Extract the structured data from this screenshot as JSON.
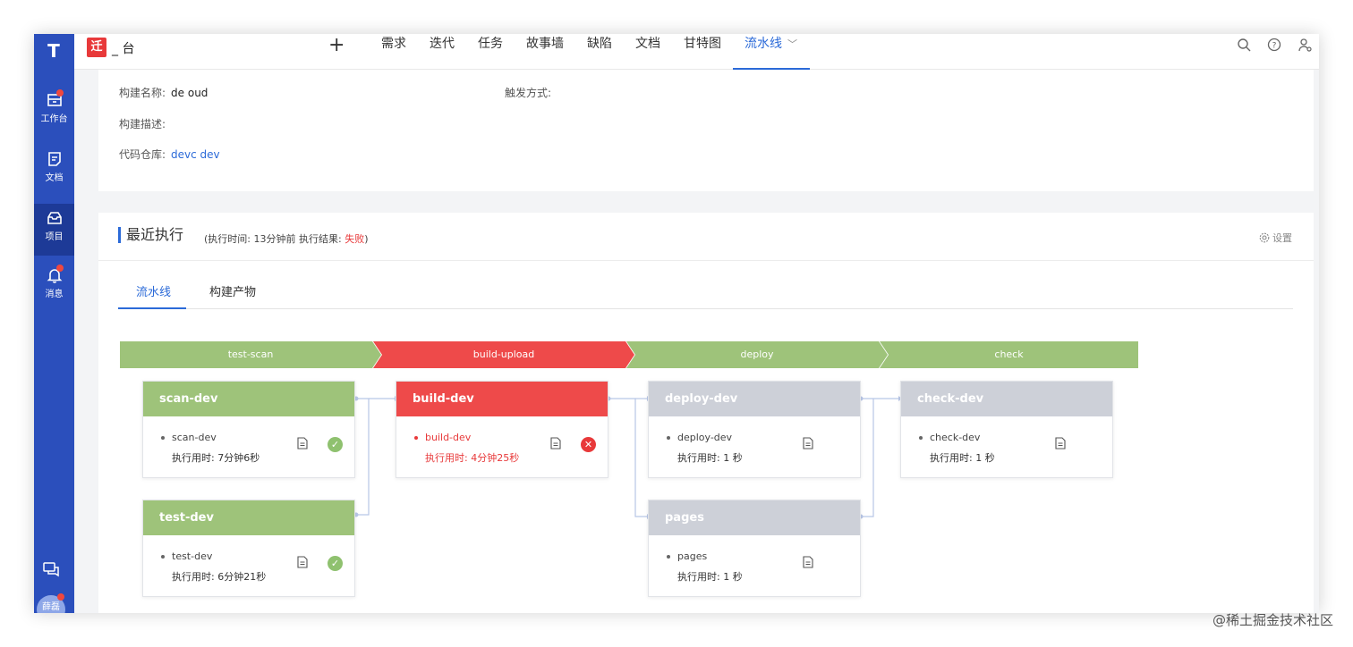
{
  "app": {
    "logo_letter": "T",
    "brand_badge": "迁",
    "brand_name": "_ 台"
  },
  "rail": {
    "items": [
      {
        "label": "工作台",
        "icon": "inbox-icon",
        "badge": true
      },
      {
        "label": "文档",
        "icon": "doc-icon",
        "badge": false
      },
      {
        "label": "项目",
        "icon": "project-icon",
        "badge": false,
        "active": true
      },
      {
        "label": "消息",
        "icon": "bell-icon",
        "badge": true
      }
    ],
    "avatar_text": "薛磊"
  },
  "nav": {
    "plus": "+",
    "tabs": [
      "需求",
      "迭代",
      "任务",
      "故事墙",
      "缺陷",
      "文档",
      "甘特图",
      "流水线"
    ],
    "active_tab": "流水线",
    "chevron": "﹀"
  },
  "build_info": {
    "name_label": "构建名称:",
    "name_value": "de          oud",
    "trigger_label": "触发方式:",
    "trigger_value": "",
    "desc_label": "构建描述:",
    "desc_value": "",
    "repo_label": "代码仓库:",
    "repo_value": "devc                     dev"
  },
  "recent": {
    "title": "最近执行",
    "meta_prefix": "(执行时间:  13分钟前    执行结果:  ",
    "result": "失败",
    "meta_suffix": ")",
    "settings": "设置",
    "tabs": [
      "流水线",
      "构建产物"
    ]
  },
  "stages": [
    {
      "label": "test-scan",
      "status": "success"
    },
    {
      "label": "build-upload",
      "status": "failed"
    },
    {
      "label": "deploy",
      "status": "success"
    },
    {
      "label": "check",
      "status": "success"
    }
  ],
  "jobs": [
    {
      "title": "scan-dev",
      "step": "scan-dev",
      "time_label": "执行用时:",
      "time": "7分钟6秒",
      "status": "success"
    },
    {
      "title": "test-dev",
      "step": "test-dev",
      "time_label": "执行用时:",
      "time": "6分钟21秒",
      "status": "success"
    },
    {
      "title": "build-dev",
      "step": "build-dev",
      "time_label": "执行用时:",
      "time": "4分钟25秒",
      "status": "failed"
    },
    {
      "title": "deploy-dev",
      "step": "deploy-dev",
      "time_label": "执行用时:",
      "time": "1 秒",
      "status": "pending"
    },
    {
      "title": "pages",
      "step": "pages",
      "time_label": "执行用时:",
      "time": "1 秒",
      "status": "pending"
    },
    {
      "title": "check-dev",
      "step": "check-dev",
      "time_label": "执行用时:",
      "time": "1 秒",
      "status": "pending"
    }
  ],
  "colors": {
    "success": "#9ec37a",
    "failed": "#ee4a4a",
    "pending": "#cdd0d8",
    "accent": "#2b6ad8"
  },
  "watermark": "@稀土掘金技术社区"
}
